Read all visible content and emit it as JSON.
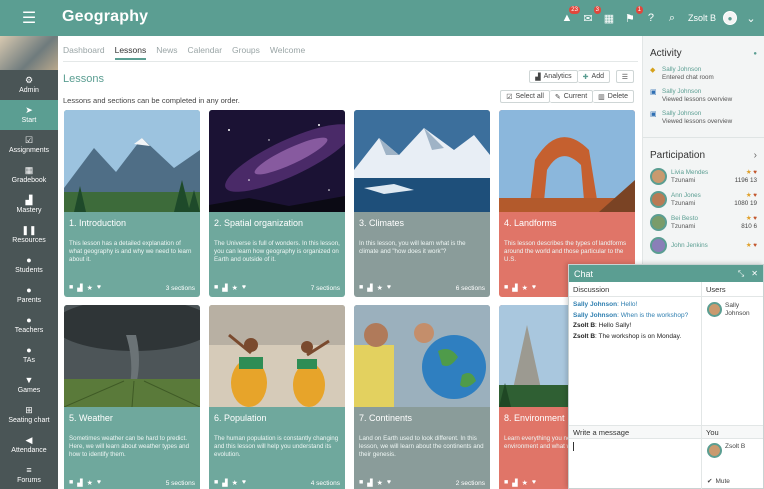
{
  "app": {
    "title": "Geography"
  },
  "topbar": {
    "badges": [
      "23",
      "3",
      "1"
    ],
    "user_name": "Zsolt B"
  },
  "sidebar": {
    "items": [
      {
        "label": "Admin",
        "icon": "gear-icon",
        "glyph": "⚙"
      },
      {
        "label": "Start",
        "icon": "send-icon",
        "glyph": "➤"
      },
      {
        "label": "Assignments",
        "icon": "check-icon",
        "glyph": "☑"
      },
      {
        "label": "Gradebook",
        "icon": "table-icon",
        "glyph": "▦"
      },
      {
        "label": "Mastery",
        "icon": "bar-chart-icon",
        "glyph": "▟"
      },
      {
        "label": "Resources",
        "icon": "books-icon",
        "glyph": "❚❚"
      },
      {
        "label": "Students",
        "icon": "person-icon",
        "glyph": "●"
      },
      {
        "label": "Parents",
        "icon": "person-icon",
        "glyph": "●"
      },
      {
        "label": "Teachers",
        "icon": "person-icon",
        "glyph": "●"
      },
      {
        "label": "TAs",
        "icon": "person-icon",
        "glyph": "●"
      },
      {
        "label": "Games",
        "icon": "trophy-icon",
        "glyph": "▼"
      },
      {
        "label": "Seating chart",
        "icon": "grid-icon",
        "glyph": "⊞"
      },
      {
        "label": "Attendance",
        "icon": "megaphone-icon",
        "glyph": "◀"
      },
      {
        "label": "Forums",
        "icon": "forum-icon",
        "glyph": "≡"
      }
    ]
  },
  "tabs": [
    "Dashboard",
    "Lessons",
    "News",
    "Calendar",
    "Groups",
    "Welcome"
  ],
  "section_title": "Lessons",
  "toolbar": {
    "analytics": "Analytics",
    "add": "Add",
    "select_all": "Select all",
    "current": "Current",
    "delete": "Delete"
  },
  "subtitle": "Lessons and sections can be completed in any order.",
  "cards": [
    {
      "title": "1. Introduction",
      "desc": "This lesson has a detailed explanation of what geography is and why we need to learn about it.",
      "sections": "3 sections",
      "color": "#6fa89d",
      "scene": "mountains"
    },
    {
      "title": "2. Spatial organization",
      "desc": "The Universe is full of wonders. In this lesson, you can learn how geography is organized on Earth and outside of it.",
      "sections": "7 sections",
      "color": "#6fa89d",
      "scene": "space"
    },
    {
      "title": "3. Climates",
      "desc": "In this lesson, you will learn what is the climate and \"how does it work\"?",
      "sections": "6 sections",
      "color": "#8a9c9a",
      "scene": "glacier"
    },
    {
      "title": "4. Landforms",
      "desc": "This lesson describes the types of landforms around the world and those particular to the U.S.",
      "sections": "",
      "color": "#e07568",
      "scene": "arch"
    },
    {
      "title": "5. Weather",
      "desc": "Sometimes weather can be hard to predict. Here, we will learn about weather types and how to identify them.",
      "sections": "5 sections",
      "color": "#6fa89d",
      "scene": "storm"
    },
    {
      "title": "6. Population",
      "desc": "The human population is constantly changing and this lesson will help you understand its evolution.",
      "sections": "4 sections",
      "color": "#6fa89d",
      "scene": "dancers"
    },
    {
      "title": "7. Continents",
      "desc": "Land on Earth used to look different. In this lesson, we will learn about the continents and their genesis.",
      "sections": "2 sections",
      "color": "#8a9c9a",
      "scene": "globe"
    },
    {
      "title": "8. Environment",
      "desc": "Learn everything you need to know about the environment and what we can do",
      "sections": "",
      "color": "#e07568",
      "scene": "valley"
    }
  ],
  "activity": {
    "title": "Activity",
    "items": [
      {
        "who": "Sally Johnson",
        "what": "Entered chat room",
        "icon": "chat-icon"
      },
      {
        "who": "Sally Johnson",
        "what": "Viewed lessons overview",
        "icon": "page-icon"
      },
      {
        "who": "Sally Johnson",
        "what": "Viewed lessons overview",
        "icon": "page-icon"
      }
    ]
  },
  "participation": {
    "title": "Participation",
    "rows": [
      {
        "name": "Livia Mendes",
        "sub": "Tzunami",
        "a": "1196",
        "b": "13"
      },
      {
        "name": "Ann Jones",
        "sub": "Tzunami",
        "a": "1080",
        "b": "19"
      },
      {
        "name": "Bei Besto",
        "sub": "Tzunami",
        "a": "810",
        "b": "6"
      },
      {
        "name": "John Jenkins",
        "sub": "",
        "a": "",
        "b": ""
      }
    ]
  },
  "chat": {
    "title": "Chat",
    "discussion_label": "Discussion",
    "users_label": "Users",
    "messages": [
      {
        "who": "Sally Johnson",
        "text": "Hello!",
        "kind": "sally"
      },
      {
        "who": "Sally Johnson",
        "text": "When is the workshop?",
        "kind": "sally"
      },
      {
        "who": "Zsolt B",
        "text": "Hello Sally!",
        "kind": "zsolt"
      },
      {
        "who": "Zsolt B",
        "text": "The workshop is on Monday.",
        "kind": "zsolt"
      }
    ],
    "user_list": [
      "Sally Johnson"
    ],
    "write_label": "Write a message",
    "you_label": "You",
    "you_name": "Zsolt B",
    "mute_label": "Mute"
  }
}
